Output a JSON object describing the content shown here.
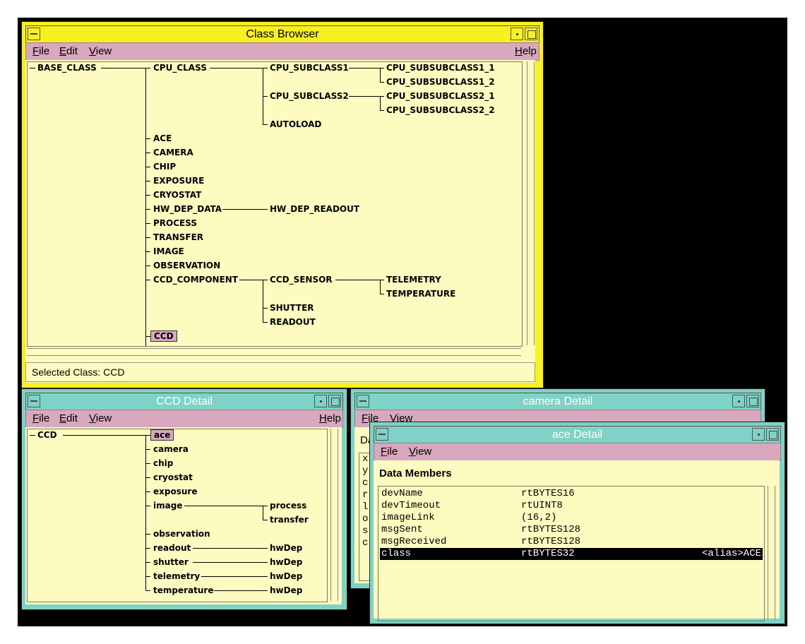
{
  "class_browser": {
    "title": "Class Browser",
    "menu": {
      "file": "File",
      "edit": "Edit",
      "view": "View",
      "help": "Help"
    },
    "tree": {
      "base": "BASE_CLASS",
      "cpu": "CPU_CLASS",
      "cpu_sub1": "CPU_SUBCLASS1",
      "cpu_sub1_1": "CPU_SUBSUBCLASS1_1",
      "cpu_sub1_2": "CPU_SUBSUBCLASS1_2",
      "cpu_sub2": "CPU_SUBCLASS2",
      "cpu_sub2_1": "CPU_SUBSUBCLASS2_1",
      "cpu_sub2_2": "CPU_SUBSUBCLASS2_2",
      "autoload": "AUTOLOAD",
      "ace": "ACE",
      "camera": "CAMERA",
      "chip": "CHIP",
      "exposure": "EXPOSURE",
      "cryostat": "CRYOSTAT",
      "hw_dep_data": "HW_DEP_DATA",
      "hw_dep_readout": "HW_DEP_READOUT",
      "process": "PROCESS",
      "transfer": "TRANSFER",
      "image": "IMAGE",
      "observation": "OBSERVATION",
      "ccd_component": "CCD_COMPONENT",
      "ccd_sensor": "CCD_SENSOR",
      "telemetry": "TELEMETRY",
      "temperature": "TEMPERATURE",
      "shutter": "SHUTTER",
      "readout": "READOUT",
      "ccd": "CCD"
    },
    "status": "Selected Class: CCD"
  },
  "ccd_detail": {
    "title": "CCD Detail",
    "menu": {
      "file": "File",
      "edit": "Edit",
      "view": "View",
      "help": "Help"
    },
    "tree": {
      "root": "CCD",
      "ace": "ace",
      "camera": "camera",
      "chip": "chip",
      "cryostat": "cryostat",
      "exposure": "exposure",
      "image": "image",
      "process": "process",
      "transfer": "transfer",
      "observation": "observation",
      "readout": "readout",
      "shutter": "shutter",
      "telemetry": "telemetry",
      "temperature": "temperature",
      "hwdep": "hwDep"
    }
  },
  "camera_detail": {
    "title": "camera Detail",
    "menu": {
      "file": "File",
      "view": "View"
    },
    "partial_label": "Da",
    "partial_col": [
      "x",
      "y",
      "c",
      "r",
      "l",
      "o",
      "s",
      "c"
    ]
  },
  "ace_detail": {
    "title": "ace Detail",
    "menu": {
      "file": "File",
      "view": "View"
    },
    "section": "Data Members",
    "rows": [
      {
        "name": "devName",
        "type": "rtBYTES16",
        "extra": ""
      },
      {
        "name": "devTimeout",
        "type": "rtUINT8",
        "extra": ""
      },
      {
        "name": "imageLink",
        "type": "(16,2)",
        "extra": ""
      },
      {
        "name": "msgSent",
        "type": "rtBYTES128",
        "extra": ""
      },
      {
        "name": "msgReceived",
        "type": "rtBYTES128",
        "extra": ""
      },
      {
        "name": "class",
        "type": "rtBYTES32",
        "extra": "<alias>ACE"
      }
    ]
  }
}
